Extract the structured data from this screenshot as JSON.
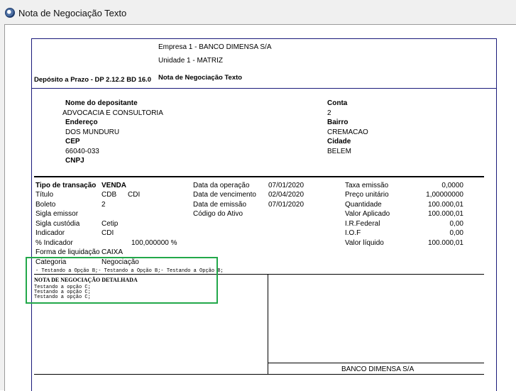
{
  "window": {
    "title": "Nota de Negociação Texto"
  },
  "header": {
    "empresa": "Empresa  1 - BANCO DIMENSA S/A",
    "unidade": "Unidade  1 - MATRIZ",
    "produto": "Depósito a Prazo -  DP 2.12.2 BD 16.0",
    "doc_title": "Nota de Negociação Texto"
  },
  "depositante": {
    "nome_label": "Nome do depositante",
    "nome": "ADVOCACIA E CONSULTORIA",
    "endereco_label": "Endereço",
    "endereco": "DOS MUNDURU",
    "cep_label": "CEP",
    "cep": "66040-033",
    "cnpj_label": "CNPJ",
    "conta_label": "Conta",
    "conta": "2",
    "bairro_label": "Bairro",
    "bairro": "CREMACAO",
    "cidade_label": "Cidade",
    "cidade": "BELEM"
  },
  "transacao": {
    "tipo_label": "Tipo de transação",
    "tipo": "VENDA",
    "titulo_label": "Título",
    "titulo_1": "CDB",
    "titulo_2": "CDI",
    "boleto_label": "Boleto",
    "boleto": "2",
    "sigla_emissor_label": "Sigla emissor",
    "sigla_custodia_label": "Sigla custódia",
    "sigla_custodia": "Cetip",
    "indicador_label": "Indicador",
    "indicador": "CDI",
    "pct_indicador_label": "% Indicador",
    "pct_indicador": "100,000000 %",
    "forma_liquidacao_label": "Forma de liquidação",
    "forma_liquidacao": "CAIXA",
    "categoria_label": "Categoria",
    "categoria": "Negociação",
    "data_operacao_label": "Data da operação",
    "data_operacao": "07/01/2020",
    "data_vencimento_label": "Data de vencimento",
    "data_vencimento": "02/04/2020",
    "data_emissao_label": "Data de emissão",
    "data_emissao": "07/01/2020",
    "codigo_ativo_label": "Código do Ativo",
    "taxa_emissao_label": "Taxa emissão",
    "taxa_emissao": "0,0000",
    "preco_unitario_label": "Preço unitário",
    "preco_unitario": "1,00000000",
    "quantidade_label": "Quantidade",
    "quantidade": "100.000,01",
    "valor_aplicado_label": "Valor Aplicado",
    "valor_aplicado": "100.000,01",
    "ir_federal_label": "I.R.Federal",
    "ir_federal": "0,00",
    "iof_label": "I.O.F",
    "iof": "0,00",
    "valor_liquido_label": "Valor líquido",
    "valor_liquido": "100.000,01"
  },
  "opcoes_line": "- Testando a Opção B;- Testando a Opção B;- Testando a Opção B;",
  "detalhada": {
    "title": "NOTA DE NEGOCIAÇÃO DETALHADA",
    "lines": [
      "Testando a opção C;",
      "Testando a opção C;",
      "Testando a opção C;"
    ]
  },
  "footer": {
    "bank": "BANCO DIMENSA S/A"
  },
  "colors": {
    "highlight": "#22a84a",
    "doc_border": "#1a1a7a"
  }
}
